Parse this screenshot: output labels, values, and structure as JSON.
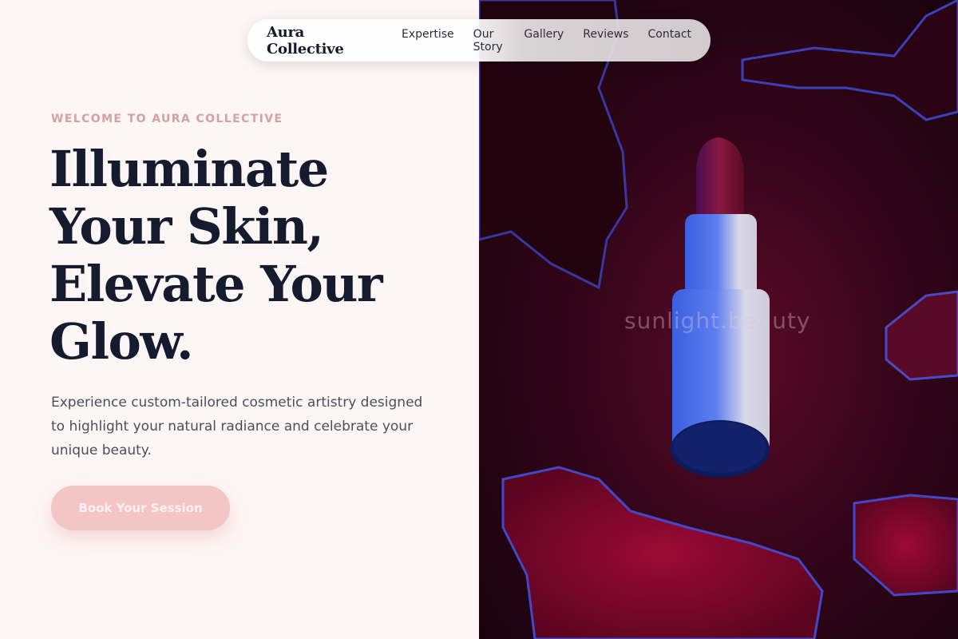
{
  "nav": {
    "brand": "Aura Collective",
    "links": [
      "Expertise",
      "Our Story",
      "Gallery",
      "Reviews",
      "Contact"
    ]
  },
  "hero": {
    "eyebrow": "WELCOME TO AURA COLLECTIVE",
    "headline_lines": [
      "Illuminate",
      "Your Skin,",
      "Elevate Your",
      "Glow."
    ],
    "subtext": "Experience custom-tailored cosmetic artistry designed to highlight your natural radiance and celebrate your unique beauty.",
    "cta_label": "Book Your Session"
  },
  "image": {
    "watermark": "sunlight.beauty",
    "subject": "lipstick-on-liquid-background"
  },
  "colors": {
    "background": "#fdf6f5",
    "eyebrow": "#d4a0a4",
    "headline": "#141b2e",
    "body_text": "#4a4f5e",
    "cta_background": "#f3c5c5",
    "cta_text": "#fdf1f1"
  }
}
